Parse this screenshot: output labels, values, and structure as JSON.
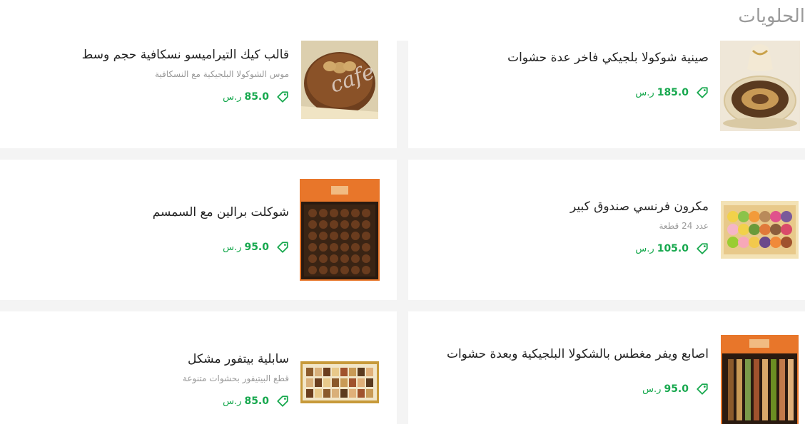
{
  "section": {
    "title": "الحلويات"
  },
  "currency": "ر.س",
  "items": [
    {
      "name": "صينية شوكولا بلجيكي فاخر عدة حشوات",
      "desc": "",
      "price": "185.0"
    },
    {
      "name": "قالب كيك التيراميسو نسكافية حجم وسط",
      "desc": "موس الشوكولا البلجيكية مع النسكافية",
      "price": "85.0",
      "watermark": "cafe"
    },
    {
      "name": "مكرون فرنسي صندوق كبير",
      "desc": "عدد 24 قطعة",
      "price": "105.0"
    },
    {
      "name": "شوكلت برالين مع السمسم",
      "desc": "",
      "price": "95.0"
    },
    {
      "name": "اصابع ويفر مغطس بالشكولا البلجيكية وبعدة حشوات",
      "desc": "",
      "price": "95.0"
    },
    {
      "name": "سابلية بيتفور مشكل",
      "desc": "قطع البيتيفور بحشوات متنوعة",
      "price": "85.0"
    }
  ],
  "colors": {
    "price_green": "#17a84e",
    "title_gray": "#9a9a9a",
    "divider": "#f4f4f4"
  },
  "icons": {
    "price": "price-tag-icon"
  }
}
